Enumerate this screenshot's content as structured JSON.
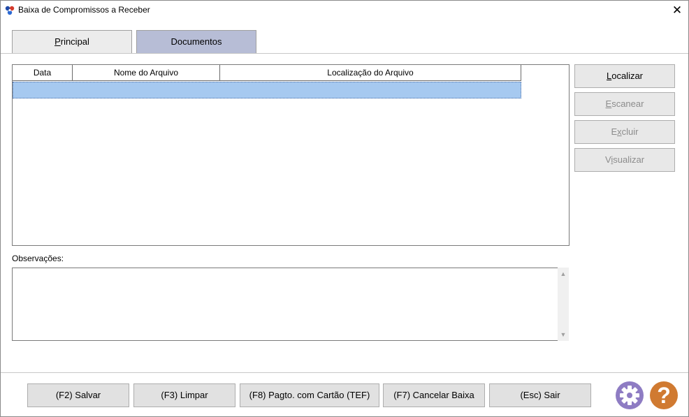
{
  "window": {
    "title": "Baixa de Compromissos a Receber",
    "close_symbol": "✕"
  },
  "tabs": [
    {
      "label_mnemonic": "P",
      "label_rest": "rincipal",
      "selected": false
    },
    {
      "label": "Documentos",
      "selected": true
    }
  ],
  "grid": {
    "columns": [
      "Data",
      "Nome do Arquivo",
      "Localização do Arquivo"
    ],
    "rows": [
      {
        "data": "",
        "nome": "",
        "local": ""
      }
    ]
  },
  "side_buttons": {
    "localizar": {
      "pre": "",
      "mnemonic": "L",
      "post": "ocalizar"
    },
    "escanear": {
      "pre": "",
      "mnemonic": "E",
      "post": "scanear"
    },
    "excluir": {
      "pre": "E",
      "mnemonic": "x",
      "post": "cluir"
    },
    "visualizar": {
      "pre": "V",
      "mnemonic": "i",
      "post": "sualizar"
    }
  },
  "observacoes": {
    "label": "Observações:",
    "value": ""
  },
  "bottom_buttons": {
    "salvar": "(F2) Salvar",
    "limpar": "(F3) Limpar",
    "tef": "(F8) Pagto. com Cartão (TEF)",
    "cancelar": "(F7) Cancelar Baixa",
    "sair": "(Esc) Sair"
  },
  "icons": {
    "settings": "gear-icon",
    "help_symbol": "?"
  },
  "colors": {
    "selected_tab": "#b7bdd6",
    "selected_row": "#a6c9f0",
    "gear": "#8e7cc3",
    "help": "#d07a31"
  }
}
